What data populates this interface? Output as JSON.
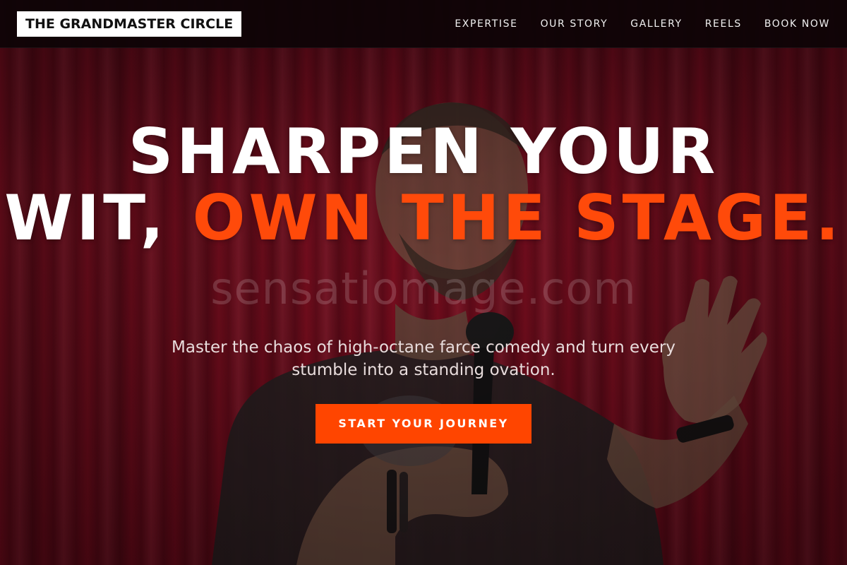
{
  "header": {
    "brand": "THE GRANDMASTER CIRCLE",
    "nav": [
      "EXPERTISE",
      "OUR STORY",
      "GALLERY",
      "REELS",
      "BOOK NOW"
    ]
  },
  "hero": {
    "headline_part1": "SHARPEN YOUR",
    "headline_part2": "WIT,",
    "headline_accent": "OWN THE STAGE.",
    "subtitle": "Master the chaos of high-octane farce comedy and turn every stumble into a standing ovation.",
    "cta_label": "START YOUR JOURNEY",
    "watermark": "sensatiomage.com"
  },
  "colors": {
    "accent": "#ff4500",
    "curtain": "#8e1024",
    "header_bg": "#0e0406",
    "headline": "#ffffff"
  }
}
